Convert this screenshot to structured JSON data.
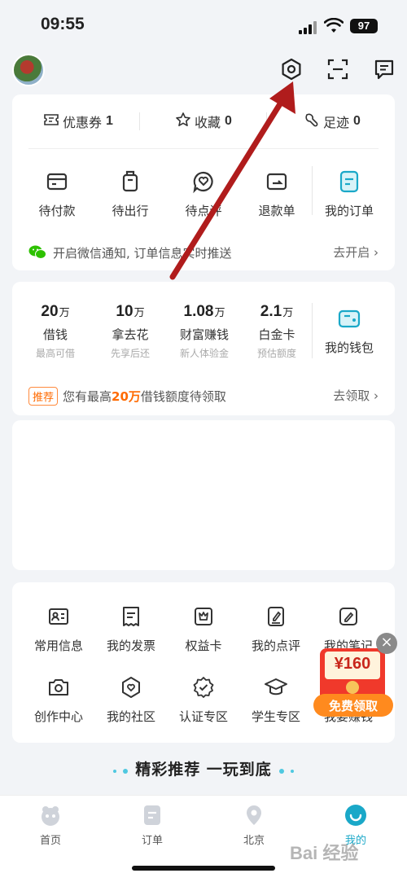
{
  "status": {
    "time": "09:55",
    "battery": "97"
  },
  "stats": [
    {
      "label": "优惠券",
      "count": "1",
      "icon": "coupon-icon"
    },
    {
      "label": "收藏",
      "count": "0",
      "icon": "star-icon"
    },
    {
      "label": "足迹",
      "count": "0",
      "icon": "footprint-icon"
    }
  ],
  "orders": [
    {
      "label": "待付款",
      "icon": "wallet-card-icon"
    },
    {
      "label": "待出行",
      "icon": "luggage-icon"
    },
    {
      "label": "待点评",
      "icon": "review-icon"
    },
    {
      "label": "退款单",
      "icon": "refund-icon"
    },
    {
      "label": "我的订单",
      "icon": "order-doc-icon"
    }
  ],
  "notice": {
    "text": "开启微信通知, 订单信息实时推送",
    "action": "去开启 ›"
  },
  "wallet": [
    {
      "amount": "20",
      "unit": "万",
      "name": "借钱",
      "sub": "最高可借"
    },
    {
      "amount": "10",
      "unit": "万",
      "name": "拿去花",
      "sub": "先享后还"
    },
    {
      "amount": "1.08",
      "unit": "万",
      "name": "财富赚钱",
      "sub": "新人体验金"
    },
    {
      "amount": "2.1",
      "unit": "万",
      "name": "白金卡",
      "sub": "预估额度"
    }
  ],
  "my_wallet": "我的钱包",
  "recommend": {
    "tag": "推荐",
    "pre": "您有最高",
    "highlight": "20万",
    "post": "借钱额度待领取",
    "action": "去领取 ›"
  },
  "services_row1": [
    {
      "label": "常用信息",
      "icon": "id-card-icon"
    },
    {
      "label": "我的发票",
      "icon": "invoice-icon"
    },
    {
      "label": "权益卡",
      "icon": "benefit-card-icon"
    },
    {
      "label": "我的点评",
      "icon": "edit-review-icon"
    },
    {
      "label": "我的笔记",
      "icon": "note-pen-icon"
    }
  ],
  "services_row2": [
    {
      "label": "创作中心",
      "icon": "camera-icon"
    },
    {
      "label": "我的社区",
      "icon": "community-icon"
    },
    {
      "label": "认证专区",
      "icon": "verified-badge-icon"
    },
    {
      "label": "学生专区",
      "icon": "graduation-cap-icon"
    },
    {
      "label": "我要赚钱",
      "icon": "money-icon"
    }
  ],
  "promo": {
    "amount": "¥160",
    "button": "免费领取"
  },
  "banner": "精彩推荐 一玩到底",
  "tabs": [
    {
      "label": "首页",
      "icon": "home-mascot-icon"
    },
    {
      "label": "订单",
      "icon": "order-tab-icon"
    },
    {
      "label": "北京",
      "icon": "location-pin-icon"
    },
    {
      "label": "我的",
      "icon": "profile-smile-icon",
      "active": true
    }
  ],
  "watermark": "Bai 经验",
  "colors": {
    "accent": "#1aa8c8",
    "orange": "#ff6a00",
    "arrow": "#b01c1c",
    "bg": "#f2f4f7"
  }
}
